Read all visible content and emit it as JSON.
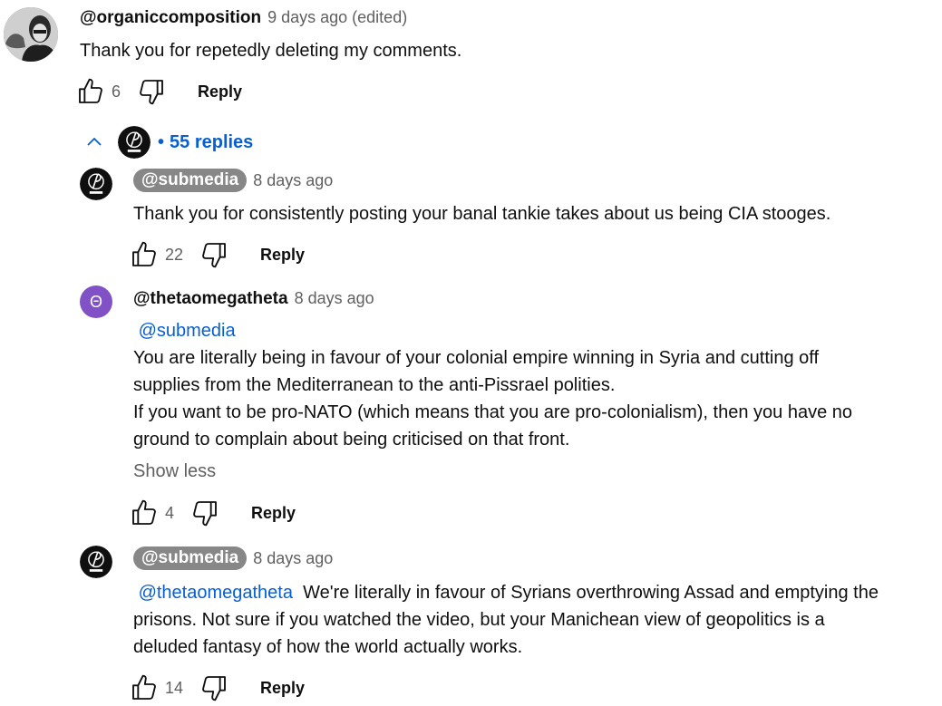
{
  "comments": [
    {
      "author": "@organiccomposition",
      "time": "9 days ago (edited)",
      "text": "Thank you for repetedly deleting my comments.",
      "likes": "6",
      "reply_label": "Reply"
    },
    {
      "author": "@submedia",
      "time": "8 days ago",
      "text": "Thank you for consistently posting your banal tankie takes about us being CIA stooges.",
      "likes": "22",
      "reply_label": "Reply"
    },
    {
      "author": "@thetaomegatheta",
      "avatar_letter": "Θ",
      "time": "8 days ago",
      "mention": "@submedia",
      "text_lines": [
        "You are literally being in favour of your colonial empire winning in Syria and cutting off",
        "supplies from the Mediterranean to the anti-Pissrael polities.",
        "If you want to be pro-NATO (which means that you are pro-colonialism), then you have no",
        "ground to complain about being criticised on that front."
      ],
      "show_less": "Show less",
      "likes": "4",
      "reply_label": "Reply"
    },
    {
      "author": "@submedia",
      "time": "8 days ago",
      "mention": "@thetaomegatheta",
      "text_line1": "We're literally in favour of Syrians overthrowing Assad and emptying the",
      "text_lines": [
        "prisons.  Not sure if you watched the video, but your Manichean view of geopolitics is a",
        "deluded fantasy of how the world actually works."
      ],
      "likes": "14",
      "reply_label": "Reply"
    }
  ],
  "thread": {
    "bullet": "•",
    "replies_label": "55 replies"
  },
  "colors": {
    "link": "#065fd4",
    "secondary_text": "#606060",
    "author_chip": "#878787",
    "avatar_purple": "#8152c6"
  },
  "icons": [
    "thumbs-up-icon",
    "thumbs-down-icon",
    "chevron-up-icon"
  ]
}
